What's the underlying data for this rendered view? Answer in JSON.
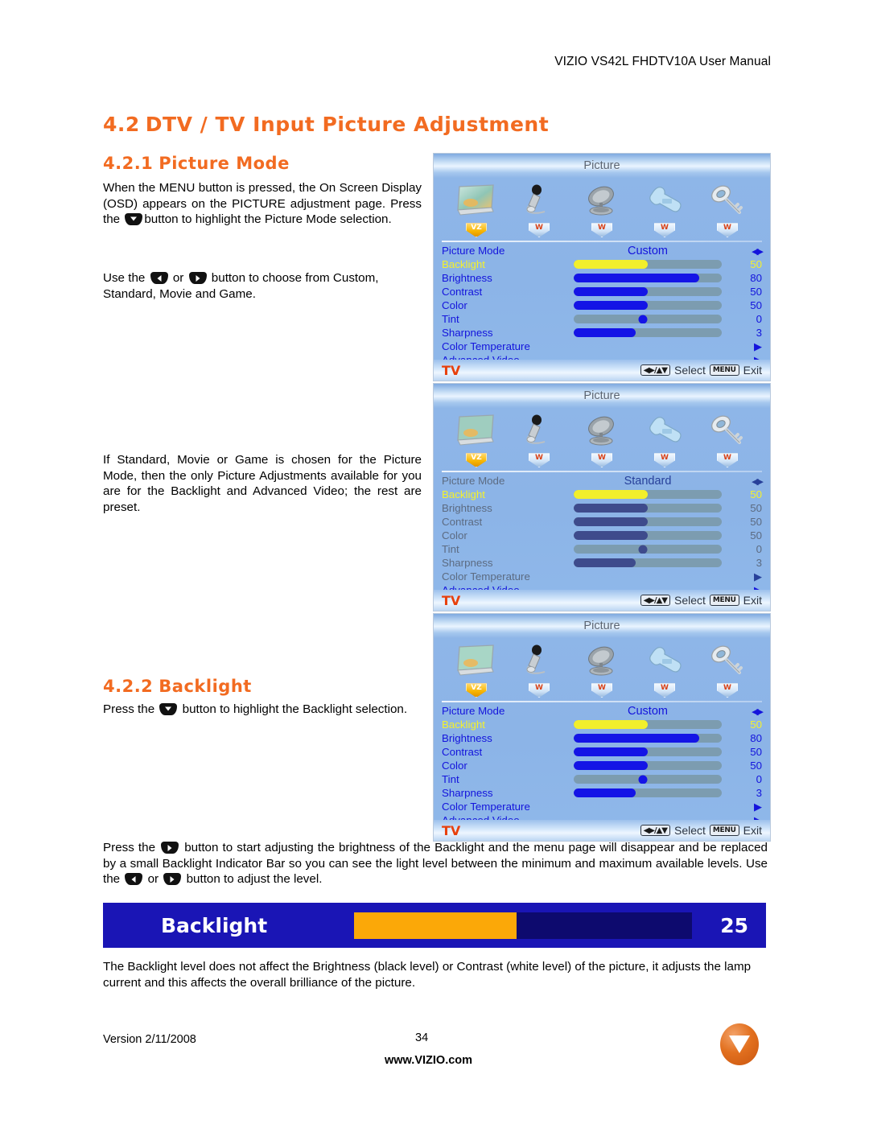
{
  "header": {
    "title": "VIZIO VS42L FHDTV10A User Manual"
  },
  "sections": {
    "s42": {
      "num": "4.2",
      "title": "DTV / TV Input Picture Adjustment"
    },
    "s421": {
      "num": "4.2.1",
      "title": "Picture Mode"
    },
    "s422": {
      "num": "4.2.2",
      "title": "Backlight"
    }
  },
  "paragraphs": {
    "p1_a": "When the MENU button is pressed, the On Screen Display (OSD) appears on the PICTURE adjustment page.  Press the",
    "p1_b": "button to highlight the Picture Mode selection.",
    "p2_a": "Use the",
    "p2_or": "or",
    "p2_b": "button to choose from Custom, Standard, Movie and Game.",
    "p3": "If Standard, Movie or Game is chosen for the Picture Mode, then the only Picture Adjustments available for you are for the Backlight and Advanced Video; the rest are preset.",
    "p4_a": "Press the",
    "p4_b": "button to highlight the Backlight selection.",
    "p5_a": "Press the",
    "p5_b": "button to start adjusting the brightness of the Backlight and the menu page will disappear and be replaced by a small Backlight Indicator Bar so you can see the light level between the minimum and maximum available levels.  Use the",
    "p5_or": "or",
    "p5_c": "button to adjust the level.",
    "p6": "The Backlight level does not affect the Brightness (black level) or Contrast (white level) of the picture, it adjusts the lamp current and this affects the overall brilliance of the picture."
  },
  "osd_common": {
    "title": "Picture",
    "icons": [
      {
        "name": "picture-icon",
        "badge": "VZ",
        "active": true
      },
      {
        "name": "audio-icon",
        "badge": "W",
        "active": false
      },
      {
        "name": "tuner-icon",
        "badge": "W",
        "active": false
      },
      {
        "name": "setup-icon",
        "badge": "W",
        "active": false
      },
      {
        "name": "parental-icon",
        "badge": "W",
        "active": false
      }
    ],
    "footer": {
      "source": "TV",
      "nav_key": "◀▶/▲▼",
      "select": "Select",
      "menu_key": "MENU",
      "exit": "Exit"
    }
  },
  "osd_panels": [
    {
      "id": "osd1",
      "mode_label": "Picture Mode",
      "mode_value": "Custom",
      "dimmed": false,
      "rows": [
        {
          "label": "Backlight",
          "value": "50",
          "fill": 50,
          "style": "highlight"
        },
        {
          "label": "Brightness",
          "value": "80",
          "fill": 85,
          "style": "active"
        },
        {
          "label": "Contrast",
          "value": "50",
          "fill": 50,
          "style": "active"
        },
        {
          "label": "Color",
          "value": "50",
          "fill": 50,
          "style": "active"
        },
        {
          "label": "Tint",
          "value": "0",
          "fill": 47,
          "style": "knob"
        },
        {
          "label": "Sharpness",
          "value": "3",
          "fill": 42,
          "style": "active"
        },
        {
          "label": "Color Temperature",
          "value": "▶",
          "fill": null,
          "style": "arrow"
        },
        {
          "label": "Advanced Video",
          "value": "▶",
          "fill": null,
          "style": "arrow"
        }
      ]
    },
    {
      "id": "osd2",
      "mode_label": "Picture Mode",
      "mode_value": "Standard",
      "dimmed": true,
      "rows": [
        {
          "label": "Backlight",
          "value": "50",
          "fill": 50,
          "style": "highlight"
        },
        {
          "label": "Brightness",
          "value": "50",
          "fill": 50,
          "style": "muted"
        },
        {
          "label": "Contrast",
          "value": "50",
          "fill": 50,
          "style": "muted"
        },
        {
          "label": "Color",
          "value": "50",
          "fill": 50,
          "style": "muted"
        },
        {
          "label": "Tint",
          "value": "0",
          "fill": 47,
          "style": "knobmuted"
        },
        {
          "label": "Sharpness",
          "value": "3",
          "fill": 42,
          "style": "muted"
        },
        {
          "label": "Color Temperature",
          "value": "▶",
          "fill": null,
          "style": "arrowmuted"
        },
        {
          "label": "Advanced Video",
          "value": "▶",
          "fill": null,
          "style": "arrow"
        }
      ]
    },
    {
      "id": "osd3",
      "mode_label": "Picture Mode",
      "mode_value": "Custom",
      "dimmed": false,
      "rows": [
        {
          "label": "Backlight",
          "value": "50",
          "fill": 50,
          "style": "highlight"
        },
        {
          "label": "Brightness",
          "value": "80",
          "fill": 85,
          "style": "active"
        },
        {
          "label": "Contrast",
          "value": "50",
          "fill": 50,
          "style": "active"
        },
        {
          "label": "Color",
          "value": "50",
          "fill": 50,
          "style": "active"
        },
        {
          "label": "Tint",
          "value": "0",
          "fill": 47,
          "style": "knob"
        },
        {
          "label": "Sharpness",
          "value": "3",
          "fill": 42,
          "style": "active"
        },
        {
          "label": "Color Temperature",
          "value": "▶",
          "fill": null,
          "style": "arrow"
        },
        {
          "label": "Advanced Video",
          "value": "▶",
          "fill": null,
          "style": "arrow"
        }
      ]
    }
  ],
  "backlight_bar": {
    "label": "Backlight",
    "value": "25",
    "fill_percent": 48,
    "bg_color": "#1a15b5",
    "track_color": "#0d0a6e",
    "fill_color": "#FBA808"
  },
  "footer": {
    "version": "Version 2/11/2008",
    "page_number": "34",
    "website": "www.VIZIO.com",
    "logo": "vizio-logo"
  }
}
